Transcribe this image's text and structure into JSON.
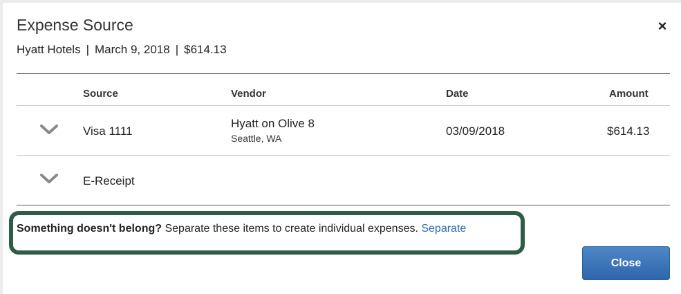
{
  "dialog": {
    "title": "Expense Source",
    "merchant": "Hyatt Hotels",
    "date": "March 9, 2018",
    "amount": "$614.13",
    "separator": "|",
    "close_icon": "×"
  },
  "table": {
    "columns": [
      "Source",
      "Vendor",
      "Date",
      "Amount"
    ],
    "rows": [
      {
        "source": "Visa 1111",
        "vendor": "Hyatt on Olive 8",
        "vendor_location": "Seattle, WA",
        "date": "03/09/2018",
        "amount": "$614.13",
        "icon": "chevron-down-icon"
      },
      {
        "source": "E-Receipt",
        "icon": "chevron-down-icon"
      }
    ]
  },
  "notice": {
    "bold": "Something doesn't belong?",
    "text": "Separate these items to create individual expenses.",
    "link": "Separate",
    "highlight_color": "#2e5d46",
    "link_color": "#2a6ab3"
  },
  "footer": {
    "close_label": "Close",
    "button_color": "#3a74b9"
  }
}
